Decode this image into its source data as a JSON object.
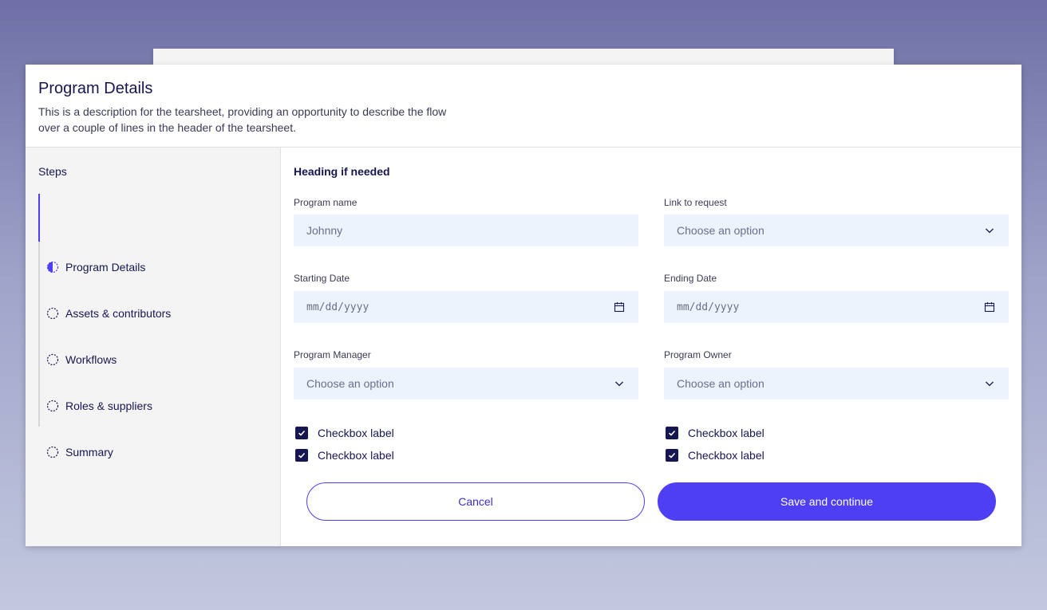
{
  "header": {
    "title": "Program Details",
    "description": "This is a description for the tearsheet, providing an opportunity to describe the flow over a couple of lines in the header of the tearsheet."
  },
  "sidebar": {
    "heading": "Steps",
    "items": [
      {
        "label": "Program Details",
        "state": "in-progress",
        "icon": "half-circle-icon"
      },
      {
        "label": "Assets & contributors",
        "state": "incomplete",
        "icon": "dashed-circle-icon"
      },
      {
        "label": "Workflows",
        "state": "incomplete",
        "icon": "dashed-circle-icon"
      },
      {
        "label": "Roles & suppliers",
        "state": "incomplete",
        "icon": "dashed-circle-icon"
      },
      {
        "label": "Summary",
        "state": "incomplete",
        "icon": "dashed-circle-icon"
      }
    ]
  },
  "form": {
    "heading": "Heading if needed",
    "program_name": {
      "label": "Program name",
      "value": "Johnny"
    },
    "link_to_request": {
      "label": "Link to request",
      "placeholder": "Choose an option"
    },
    "starting_date": {
      "label": "Starting Date",
      "placeholder": "mm/dd/yyyy"
    },
    "ending_date": {
      "label": "Ending Date",
      "placeholder": "mm/dd/yyyy"
    },
    "program_manager": {
      "label": "Program Manager",
      "placeholder": "Choose an option"
    },
    "program_owner": {
      "label": "Program Owner",
      "placeholder": "Choose an option"
    },
    "checkboxes": [
      {
        "label": "Checkbox label",
        "checked": true
      },
      {
        "label": "Checkbox label",
        "checked": true
      },
      {
        "label": "Checkbox label",
        "checked": true
      },
      {
        "label": "Checkbox label",
        "checked": true
      }
    ]
  },
  "actions": {
    "cancel_label": "Cancel",
    "save_label": "Save and continue"
  },
  "colors": {
    "accent": "#4e3ff5",
    "text": "#161650",
    "field_bg": "#edf3fd"
  }
}
